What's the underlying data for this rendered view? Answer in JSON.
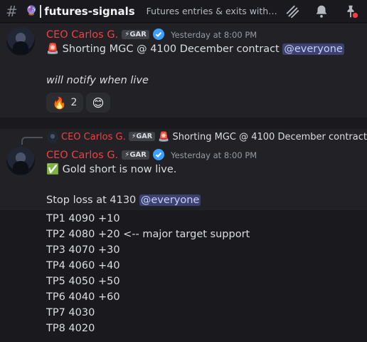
{
  "header": {
    "channel_emoji": "🔮",
    "channel_name": "futures-signals",
    "topic": "Futures entries & exits with c..."
  },
  "messages": [
    {
      "author": "CEO Carlos G.",
      "tag": "⚡GAR",
      "timestamp": "Yesterday at 8:00 PM",
      "line1_emoji": "🚨",
      "line1_text": "Shorting MGC @ 4100 December contract",
      "line1_mention": "@everyone",
      "line2_text": "will notify when live",
      "reaction_emoji": "🔥",
      "reaction_count": "2",
      "add_reaction_icon": "😊"
    },
    {
      "reply": {
        "author": "CEO Carlos G.",
        "tag": "⚡GAR",
        "emoji": "🚨",
        "text": "Shorting MGC @ 4100 December contract..."
      },
      "author": "CEO Carlos G.",
      "tag": "⚡GAR",
      "timestamp": "Yesterday at 8:00 PM",
      "line1_emoji": "✅",
      "line1_text": "Gold short is now live.",
      "stop_text": "Stop loss at 4130",
      "stop_mention": "@everyone",
      "targets": [
        "TP1 4090 +10",
        "TP2 4080 +20 <-- major target support",
        "TP3 4070 +30",
        "TP4 4060 +40",
        "TP5 4050 +50",
        "TP6 4040 +60",
        "TP7 4030",
        "TP8 4020"
      ]
    }
  ],
  "colors": {
    "username": "#f23f42",
    "mention_bg": "#3c4270",
    "verified": "#3ba0ff",
    "background": "#1a1a1e"
  }
}
